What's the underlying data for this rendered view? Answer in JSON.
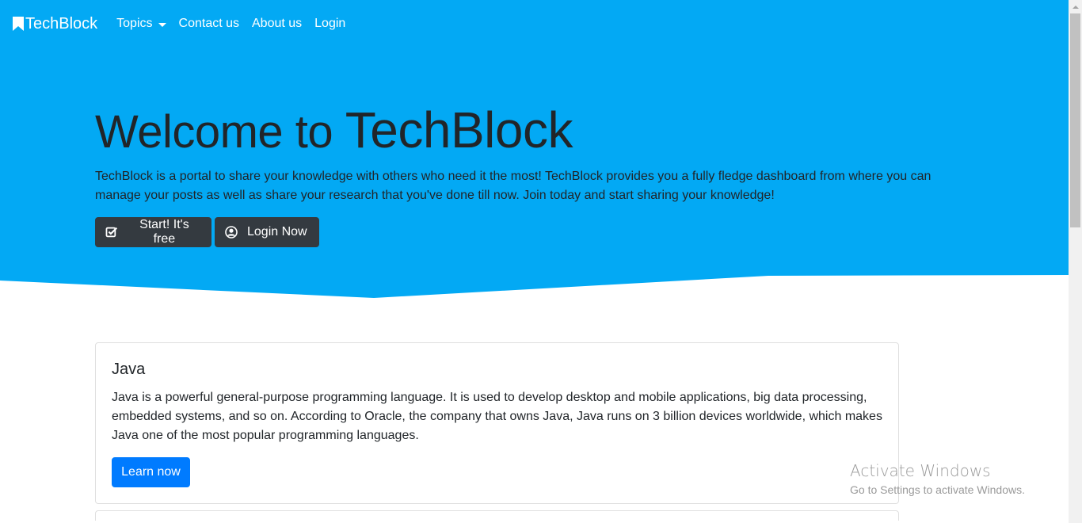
{
  "colors": {
    "hero_bg": "#03a9f4",
    "button_dark": "#343a40",
    "button_primary": "#007bff"
  },
  "navbar": {
    "brand": "TechBlock",
    "brand_icon": "bookmark-icon",
    "links": {
      "topics": "Topics",
      "contact": "Contact us",
      "about": "About us",
      "login": "Login"
    }
  },
  "hero": {
    "title_prefix": "Welcome to",
    "title_brand": "TechBlock",
    "description": "TechBlock is a portal to share your knowledge with others who need it the most! TechBlock provides you a fully fledge dashboard from where you can manage your posts as well as share your research that you've done till now. Join today and start sharing your knowledge!",
    "buttons": {
      "start": {
        "label": "Start! It's free",
        "icon": "check-square-icon"
      },
      "login": {
        "label": "Login Now",
        "icon": "user-circle-icon"
      }
    }
  },
  "cards": [
    {
      "title": "Java",
      "text": "Java is a powerful general-purpose programming language. It is used to develop desktop and mobile applications, big data processing, embedded systems, and so on. According to Oracle, the company that owns Java, Java runs on 3 billion devices worldwide, which makes Java one of the most popular programming languages.",
      "button": "Learn now"
    }
  ],
  "watermark": {
    "title": "Activate Windows",
    "subtitle": "Go to Settings to activate Windows."
  }
}
